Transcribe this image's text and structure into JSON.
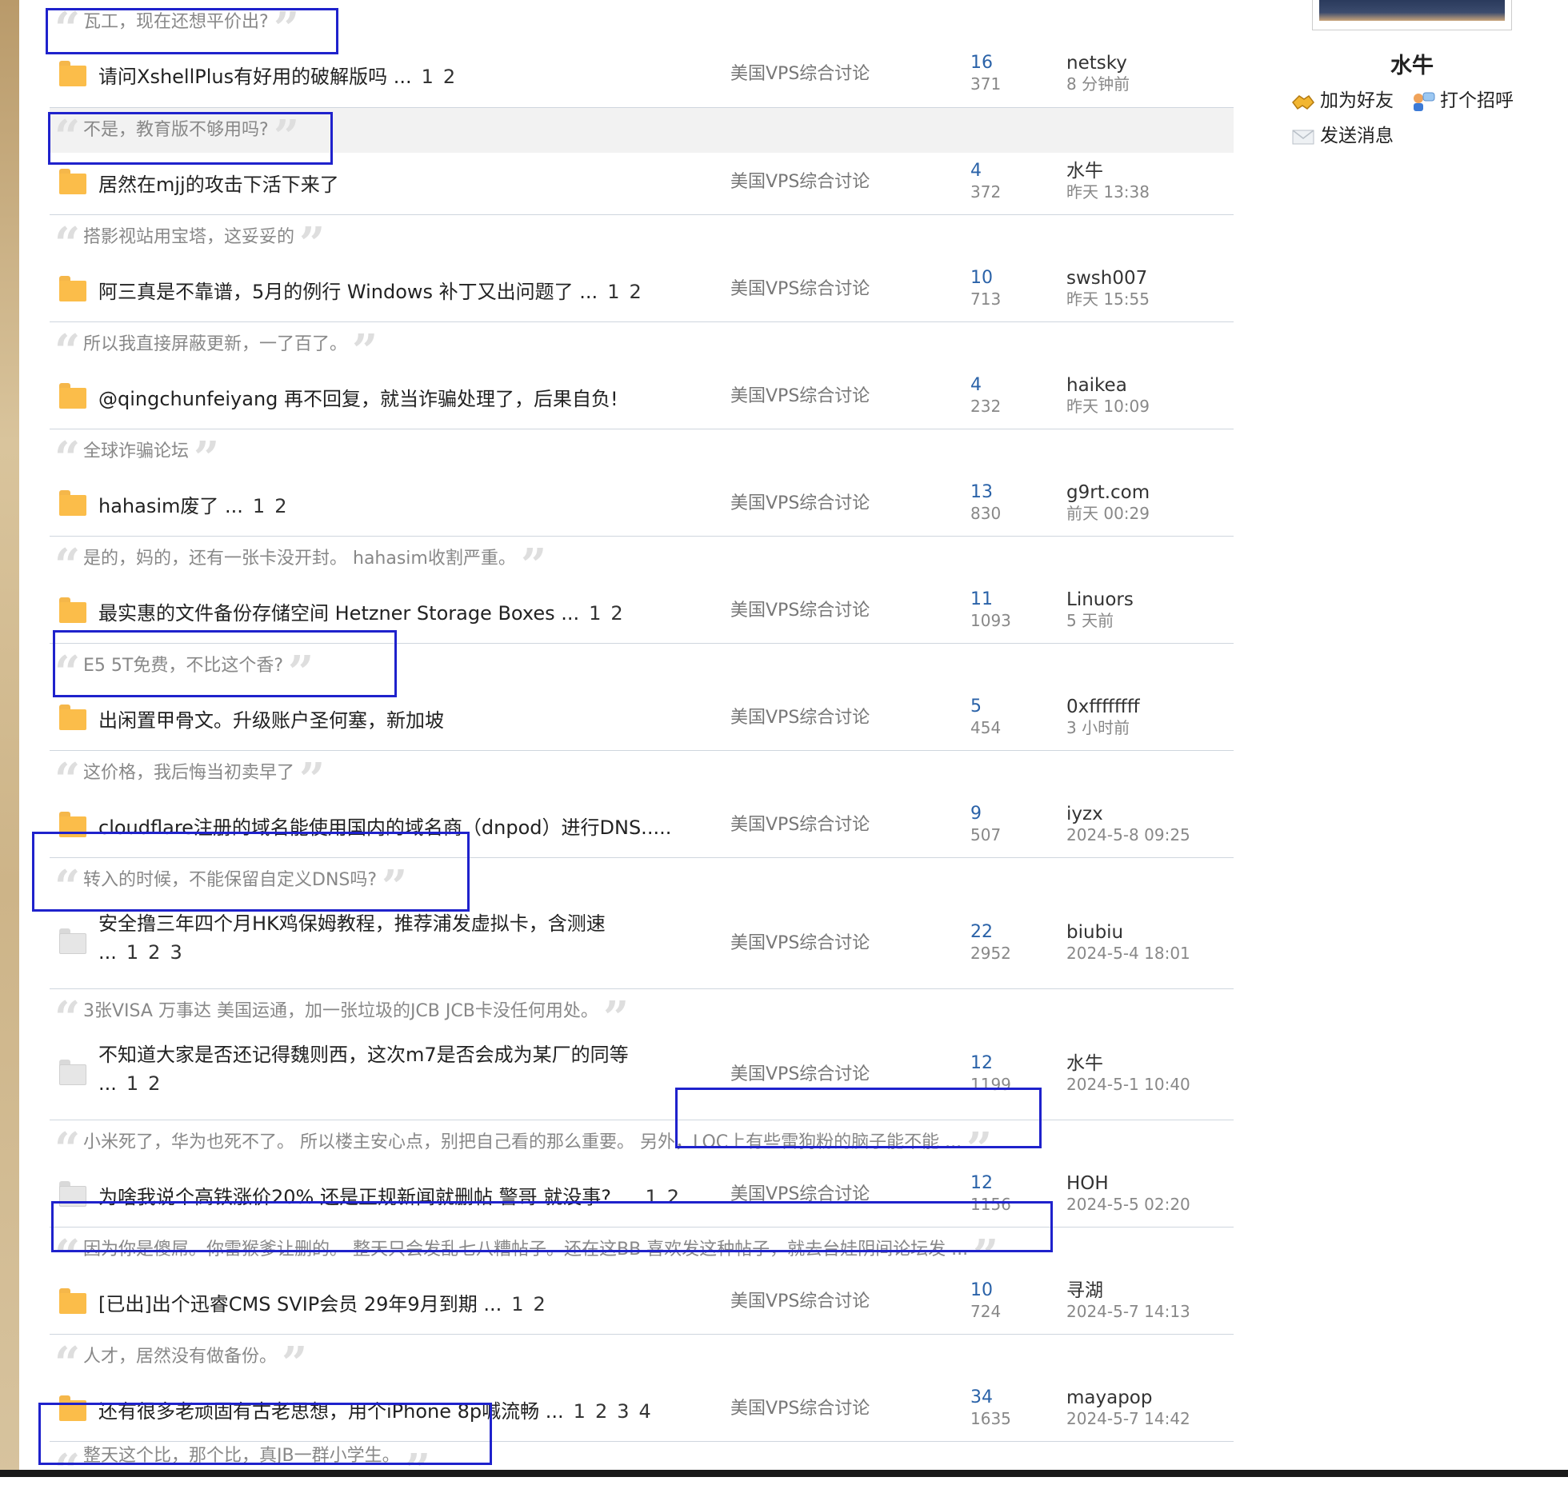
{
  "profile": {
    "name": "水牛",
    "add_friend": "加为好友",
    "greet": "打个招呼",
    "send_message": "发送消息"
  },
  "threads": [
    {
      "quote": "瓦工，现在还想平价出?",
      "title": "请问XshellPlus有好用的破解版吗 ...",
      "pages": [
        "1",
        "2"
      ],
      "forum": "美国VPS综合讨论",
      "replies": "16",
      "views": "371",
      "user": "netsky",
      "time": "8 分钟前"
    },
    {
      "quote": "不是，教育版不够用吗?",
      "title": "居然在mjj的攻击下活下来了",
      "pages": [],
      "forum": "美国VPS综合讨论",
      "replies": "4",
      "views": "372",
      "user": "水牛",
      "time": "昨天 13:38"
    },
    {
      "quote": "搭影视站用宝塔，这妥妥的",
      "title": "阿三真是不靠谱，5月的例行 Windows 补丁又出问题了 ...",
      "pages": [
        "1",
        "2"
      ],
      "forum": "美国VPS综合讨论",
      "replies": "10",
      "views": "713",
      "user": "swsh007",
      "time": "昨天 15:55"
    },
    {
      "quote": "所以我直接屏蔽更新，一了百了。",
      "title": "@qingchunfeiyang 再不回复，就当诈骗处理了，后果自负!",
      "pages": [],
      "forum": "美国VPS综合讨论",
      "replies": "4",
      "views": "232",
      "user": "haikea",
      "time": "昨天 10:09"
    },
    {
      "quote": "全球诈骗论坛",
      "title": "hahasim废了 ...",
      "pages": [
        "1",
        "2"
      ],
      "forum": "美国VPS综合讨论",
      "replies": "13",
      "views": "830",
      "user": "g9rt.com",
      "time": "前天 00:29"
    },
    {
      "quote": "是的，妈的，还有一张卡没开封。 hahasim收割严重。",
      "title": "最实惠的文件备份存储空间 Hetzner Storage Boxes ...",
      "pages": [
        "1",
        "2"
      ],
      "forum": "美国VPS综合讨论",
      "replies": "11",
      "views": "1093",
      "user": "Linuors",
      "time": "5 天前"
    },
    {
      "quote": "E5 5T免费，不比这个香?",
      "title": "出闲置甲骨文。升级账户圣何塞，新加坡",
      "pages": [],
      "forum": "美国VPS综合讨论",
      "replies": "5",
      "views": "454",
      "user": "0xffffffff",
      "time": "3 小时前"
    },
    {
      "quote": "这价格，我后悔当初卖早了",
      "title": "cloudflare注册的域名能使用国内的域名商（dnpod）进行DNS.....",
      "pages": [],
      "forum": "美国VPS综合讨论",
      "replies": "9",
      "views": "507",
      "user": "iyzx",
      "time": "2024-5-8 09:25"
    },
    {
      "quote": "转入的时候，不能保留自定义DNS吗?",
      "title": "安全撸三年四个月HK鸡保姆教程，推荐浦发虚拟卡，含测速 ...",
      "pages": [
        "1",
        "2",
        "3"
      ],
      "forum": "美国VPS综合讨论",
      "replies": "22",
      "views": "2952",
      "user": "biubiu",
      "time": "2024-5-4 18:01"
    },
    {
      "quote": "3张VISA 万事达 美国运通，加一张垃圾的JCB JCB卡没任何用处。",
      "title": "不知道大家是否还记得魏则西，这次m7是否会成为某厂的同等 ...",
      "pages": [
        "1",
        "2"
      ],
      "forum": "美国VPS综合讨论",
      "replies": "12",
      "views": "1199",
      "user": "水牛",
      "time": "2024-5-1 10:40"
    },
    {
      "quote": "小米死了，华为也死不了。 所以楼主安心点，别把自己看的那么重要。 另外，LOC上有些雷狗粉的脑子能不能 ...",
      "title": "为啥我说个高铁涨价20% 还是正规新闻就删帖 警哥 就没事? ...",
      "pages": [
        "1",
        "2"
      ],
      "forum": "美国VPS综合讨论",
      "replies": "12",
      "views": "1156",
      "user": "HOH",
      "time": "2024-5-5 02:20"
    },
    {
      "quote": "因为你是傻屌。你雷猴爹让删的。 整天只会发乱七八糟帖子。还在这BB 喜欢发这种帖子，就去台娃阴间论坛发 ...",
      "title": "[已出]出个迅睿CMS SVIP会员 29年9月到期 ...",
      "pages": [
        "1",
        "2"
      ],
      "forum": "美国VPS综合讨论",
      "replies": "10",
      "views": "724",
      "user": "寻湖",
      "time": "2024-5-7 14:13"
    },
    {
      "quote": "人才，居然没有做备份。",
      "title": "还有很多老顽固有古老思想，用个iPhone 8p喊流畅 ...",
      "pages": [
        "1",
        "2",
        "3",
        "4"
      ],
      "forum": "美国VPS综合讨论",
      "replies": "34",
      "views": "1635",
      "user": "mayapop",
      "time": "2024-5-7 14:42"
    },
    {
      "quote": "整天这个比，那个比，真JB一群小学生。",
      "title": "",
      "pages": [],
      "forum": "",
      "replies": "",
      "views": "",
      "user": "",
      "time": ""
    }
  ]
}
